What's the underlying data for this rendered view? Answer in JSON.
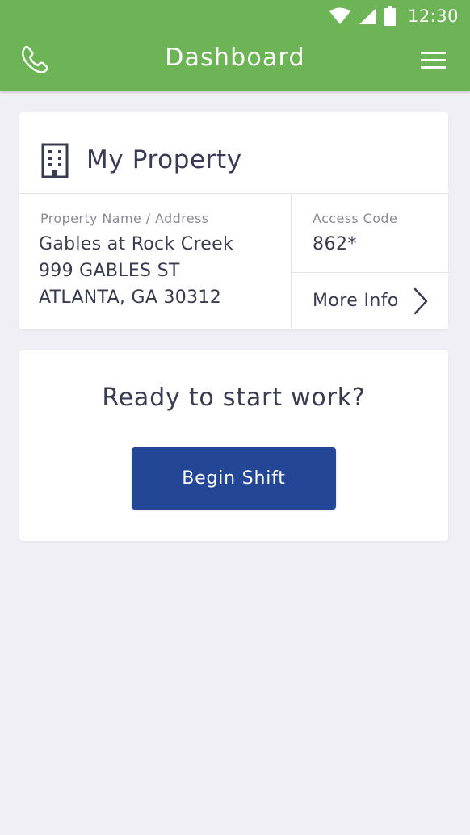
{
  "status_bar": {
    "time": "12:30",
    "icons": [
      "wifi-icon",
      "cellular-signal-icon",
      "battery-icon"
    ]
  },
  "app_bar": {
    "title": "Dashboard",
    "left_icon": "phone-icon",
    "right_icon": "menu-icon",
    "color": "#6db456"
  },
  "property_card": {
    "title": "My Property",
    "title_icon": "building-icon",
    "name_address_label": "Property Name / Address",
    "property_name": "Gables at Rock Creek",
    "address_line1": "999 GABLES ST",
    "address_line2": "ATLANTA, GA 30312",
    "access_code_label": "Access Code",
    "access_code": "862*",
    "more_info_label": "More Info"
  },
  "work_card": {
    "prompt": "Ready to start work?",
    "button_label": "Begin Shift",
    "button_color": "#244696"
  }
}
